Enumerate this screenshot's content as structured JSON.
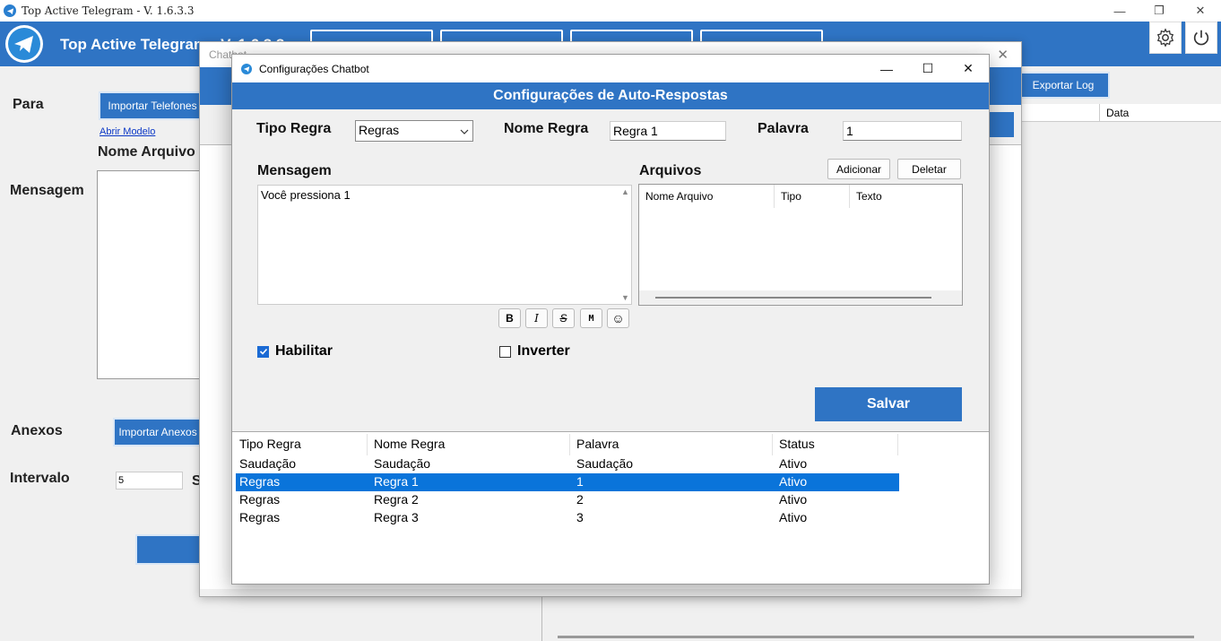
{
  "window": {
    "title": "Top Active Telegram - V. 1.6.3.3",
    "app_title": "Top Active Telegram - V. 1.6.3.3"
  },
  "main": {
    "para_label": "Para",
    "import_phones_label": "Importar Telefones",
    "open_model_link": "Abrir Modelo",
    "file_name_label": "Nome Arquivo",
    "message_label": "Mensagem",
    "attachments_label": "Anexos",
    "import_attachments_label": "Importar Anexos",
    "interval_label": "Intervalo",
    "interval_value": "5",
    "interval_unit": "S",
    "export_log_label": "Exportar Log",
    "log_column_data": "Data"
  },
  "chatbot_window": {
    "title": "Chatbot"
  },
  "dialog": {
    "title": "Configurações Chatbot",
    "header": "Configurações de Auto-Respostas",
    "tipo_regra_label": "Tipo Regra",
    "tipo_regra_value": "Regras",
    "nome_regra_label": "Nome Regra",
    "nome_regra_value": "Regra 1",
    "palavra_label": "Palavra",
    "palavra_value": "1",
    "mensagem_label": "Mensagem",
    "mensagem_value": "Você pressiona 1",
    "arquivos_label": "Arquivos",
    "add_button": "Adicionar",
    "delete_button": "Deletar",
    "file_columns": [
      "Nome Arquivo",
      "Tipo",
      "Texto"
    ],
    "format_buttons": [
      "B",
      "I",
      "S",
      "M",
      "☺"
    ],
    "habilitar_label": "Habilitar",
    "habilitar_checked": true,
    "inverter_label": "Inverter",
    "inverter_checked": false,
    "save_button": "Salvar",
    "rules_table": {
      "columns": [
        "Tipo Regra",
        "Nome Regra",
        "Palavra",
        "Status"
      ],
      "rows": [
        [
          "Saudação",
          "Saudação",
          "Saudação",
          "Ativo"
        ],
        [
          "Regras",
          "Regra 1",
          "1",
          "Ativo"
        ],
        [
          "Regras",
          "Regra 2",
          "2",
          "Ativo"
        ],
        [
          "Regras",
          "Regra 3",
          "3",
          "Ativo"
        ]
      ],
      "selected_row": 1
    }
  },
  "colors": {
    "brand_blue": "#2f74c4",
    "selection_blue": "#0a74da"
  }
}
